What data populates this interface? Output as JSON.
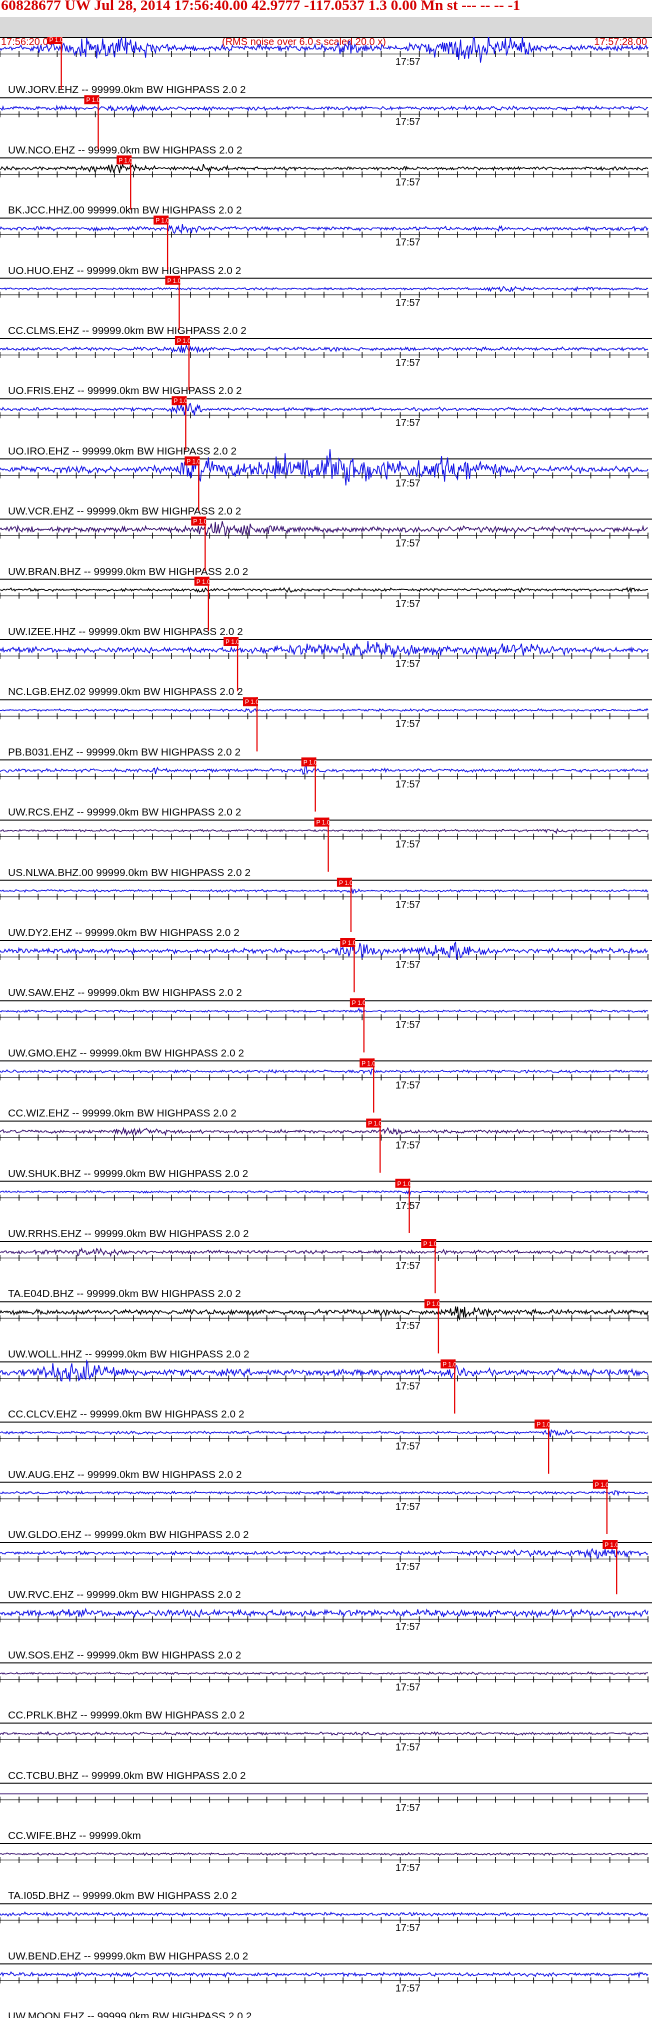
{
  "header": {
    "title": "60828677 UW Jul 28, 2014 17:56:40.00   42.9777 -117.0537  1.3 0.00 Mn st --- -- --  -1",
    "start_time": "17:56:20.00",
    "rms_note": "(RMS noise over 6.0 s scaled 20.0 x)",
    "end_time": "17:57:28.00"
  },
  "colors": {
    "blue": "#1414e6",
    "purple": "#3a1470",
    "black": "#000000",
    "pick": "#e60000",
    "line": "#000000",
    "background": "#ffffff"
  },
  "chart_data": {
    "type": "line",
    "title": "60828677 UW Jul 28, 2014 17:56:40.00   42.9777 -117.0537  1.3 0.00 Mn st --- -- --  -1",
    "x_start": "17:56:20.00",
    "x_end": "17:57:28.00",
    "time_mark": "17:57",
    "pick_label": "P 1.0",
    "note": "(RMS noise over 6.0 s scaled 20.0 x)",
    "traces": [
      {
        "label": "UW.JORV.EHZ -- 99999.0km BW  HIGHPASS  2.0  2",
        "color": "blue",
        "amp": 0.5,
        "pick": 0.073,
        "bursts": [
          [
            0.13,
            0.06,
            3.0
          ],
          [
            0.21,
            0.04,
            2.0
          ],
          [
            0.53,
            0.03,
            2.2
          ],
          [
            0.72,
            0.06,
            4.5
          ],
          [
            0.8,
            0.02,
            3.0
          ]
        ]
      },
      {
        "label": "UW.NCO.EHZ -- 99999.0km BW  HIGHPASS  2.0  2",
        "color": "blue",
        "amp": 0.35,
        "pick": 0.13,
        "bursts": [
          [
            0.2,
            0.04,
            1.2
          ]
        ]
      },
      {
        "label": "BK.JCC.HHZ.00 99999.0km BW  HIGHPASS  2.0  2",
        "color": "black",
        "amp": 0.3,
        "pick": 0.18,
        "bursts": [
          [
            0.18,
            0.04,
            2.2
          ],
          [
            0.32,
            0.03,
            1.4
          ]
        ]
      },
      {
        "label": "UO.HUO.EHZ -- 99999.0km BW  HIGHPASS  2.0  2",
        "color": "blue",
        "amp": 0.35,
        "pick": 0.237,
        "bursts": [
          [
            0.28,
            0.02,
            2.8
          ],
          [
            0.77,
            0.005,
            2.5
          ]
        ]
      },
      {
        "label": "CC.CLMS.EHZ -- 99999.0km BW  HIGHPASS  2.0  2",
        "color": "blue",
        "amp": 0.2,
        "pick": 0.255,
        "bursts": [
          [
            0.78,
            0.03,
            2.2
          ],
          [
            0.91,
            0.03,
            1.2
          ]
        ]
      },
      {
        "label": "UO.FRIS.EHZ -- 99999.0km BW  HIGHPASS  2.0  2",
        "color": "blue",
        "amp": 0.35,
        "pick": 0.27,
        "bursts": [
          [
            0.285,
            0.02,
            2.0
          ]
        ]
      },
      {
        "label": "UO.IRO.EHZ -- 99999.0km BW  HIGHPASS  2.0  2",
        "color": "blue",
        "amp": 0.3,
        "pick": 0.265,
        "bursts": [
          [
            0.29,
            0.02,
            3.0
          ]
        ]
      },
      {
        "label": "UW.VCR.EHZ -- 99999.0km BW  HIGHPASS  2.0  2",
        "color": "blue",
        "amp": 0.6,
        "pick": 0.285,
        "bursts": [
          [
            0.3,
            0.03,
            3.0
          ],
          [
            0.5,
            0.12,
            4.5
          ],
          [
            0.7,
            0.06,
            3.0
          ]
        ]
      },
      {
        "label": "UW.BRAN.BHZ -- 99999.0km BW  HIGHPASS  2.0  2",
        "color": "purple",
        "amp": 0.55,
        "pick": 0.295,
        "bursts": [
          [
            0.35,
            0.05,
            1.8
          ]
        ]
      },
      {
        "label": "UW.IZEE.HHZ -- 99999.0km BW  HIGHPASS  2.0  2",
        "color": "black",
        "amp": 0.25,
        "pick": 0.3,
        "bursts": [
          [
            0.31,
            0.005,
            2.8
          ],
          [
            0.45,
            0.01,
            1.8
          ],
          [
            0.8,
            0.01,
            1.2
          ],
          [
            0.97,
            0.01,
            1.2
          ]
        ]
      },
      {
        "label": "NC.LGB.EHZ.02 99999.0km BW  HIGHPASS  2.0  2",
        "color": "blue",
        "amp": 0.5,
        "pick": 0.345,
        "bursts": [
          [
            0.55,
            0.12,
            2.0
          ],
          [
            0.8,
            0.08,
            1.4
          ]
        ]
      },
      {
        "label": "PB.B031.EHZ -- 99999.0km BW  HIGHPASS  2.0  2",
        "color": "blue",
        "amp": 0.2,
        "pick": 0.375,
        "bursts": [
          [
            0.385,
            0.005,
            3.0
          ]
        ]
      },
      {
        "label": "UW.RCS.EHZ -- 99999.0km BW  HIGHPASS  2.0  2",
        "color": "blue",
        "amp": 0.3,
        "pick": 0.465,
        "bursts": [
          [
            0.47,
            0.004,
            3.5
          ],
          [
            0.24,
            0.005,
            1.8
          ]
        ]
      },
      {
        "label": "US.NLWA.BHZ.00 99999.0km BW  HIGHPASS  2.0  2",
        "color": "purple",
        "amp": 0.2,
        "pick": 0.485,
        "bursts": [
          [
            0.85,
            0.03,
            1.2
          ]
        ]
      },
      {
        "label": "UW.DY2.EHZ -- 99999.0km BW  HIGHPASS  2.0  2",
        "color": "blue",
        "amp": 0.2,
        "pick": 0.52,
        "bursts": [
          [
            0.545,
            0.005,
            2.2
          ]
        ]
      },
      {
        "label": "UW.SAW.EHZ -- 99999.0km BW  HIGHPASS  2.0  2",
        "color": "blue",
        "amp": 0.45,
        "pick": 0.525,
        "bursts": [
          [
            0.55,
            0.03,
            2.4
          ],
          [
            0.7,
            0.05,
            3.0
          ]
        ]
      },
      {
        "label": "UW.GMO.EHZ -- 99999.0km BW  HIGHPASS  2.0  2",
        "color": "blue",
        "amp": 0.2,
        "pick": 0.54,
        "bursts": [
          [
            0.555,
            0.005,
            1.8
          ]
        ]
      },
      {
        "label": "CC.WIZ.EHZ -- 99999.0km BW  HIGHPASS  2.0  2",
        "color": "blue",
        "amp": 0.25,
        "pick": 0.555,
        "bursts": [
          [
            0.57,
            0.01,
            1.2
          ]
        ]
      },
      {
        "label": "UW.SHUK.BHZ -- 99999.0km BW  HIGHPASS  2.0  2",
        "color": "purple",
        "amp": 0.3,
        "pick": 0.565,
        "bursts": [
          [
            0.21,
            0.04,
            2.0
          ],
          [
            0.6,
            0.02,
            1.4
          ]
        ]
      },
      {
        "label": "UW.RRHS.EHZ -- 99999.0km BW  HIGHPASS  2.0  2",
        "color": "blue",
        "amp": 0.2,
        "pick": 0.61,
        "bursts": [
          [
            0.63,
            0.005,
            2.2
          ]
        ]
      },
      {
        "label": "TA.E04D.BHZ -- 99999.0km BW  HIGHPASS  2.0  2",
        "color": "purple",
        "amp": 0.3,
        "pick": 0.65,
        "bursts": [
          [
            0.15,
            0.06,
            1.4
          ],
          [
            0.685,
            0.005,
            2.0
          ]
        ]
      },
      {
        "label": "UW.WOLL.HHZ -- 99999.0km BW  HIGHPASS  2.0  2",
        "color": "black",
        "amp": 0.5,
        "pick": 0.655,
        "bursts": [
          [
            0.72,
            0.03,
            2.2
          ]
        ]
      },
      {
        "label": "CC.CLCV.EHZ -- 99999.0km BW  HIGHPASS  2.0  2",
        "color": "blue",
        "amp": 0.6,
        "pick": 0.68,
        "bursts": [
          [
            0.12,
            0.06,
            2.6
          ],
          [
            0.7,
            0.01,
            3.0
          ]
        ]
      },
      {
        "label": "UW.AUG.EHZ -- 99999.0km BW  HIGHPASS  2.0  2",
        "color": "blue",
        "amp": 0.25,
        "pick": 0.825,
        "bursts": [
          [
            0.86,
            0.02,
            2.0
          ]
        ]
      },
      {
        "label": "UW.GLDO.EHZ -- 99999.0km BW  HIGHPASS  2.0  2",
        "color": "blue",
        "amp": 0.25,
        "pick": 0.915,
        "bursts": [
          [
            0.95,
            0.01,
            1.4
          ]
        ]
      },
      {
        "label": "UW.RVC.EHZ -- 99999.0km BW  HIGHPASS  2.0  2",
        "color": "blue",
        "amp": 0.3,
        "pick": 0.93,
        "bursts": [
          [
            0.93,
            0.04,
            3.5
          ],
          [
            0.8,
            0.06,
            1.2
          ]
        ]
      },
      {
        "label": "UW.SOS.EHZ -- 99999.0km BW  HIGHPASS  2.0  2",
        "color": "blue",
        "amp": 0.65,
        "pick": null,
        "bursts": []
      },
      {
        "label": "CC.PRLK.BHZ -- 99999.0km BW  HIGHPASS  2.0  2",
        "color": "purple",
        "amp": 0.2,
        "pick": null,
        "bursts": []
      },
      {
        "label": "CC.TCBU.BHZ -- 99999.0km BW  HIGHPASS  2.0  2",
        "color": "purple",
        "amp": 0.25,
        "pick": null,
        "bursts": []
      },
      {
        "label": "CC.WIFE.BHZ -- 99999.0km",
        "color": "purple",
        "amp": 0,
        "pick": null,
        "bursts": []
      },
      {
        "label": "TA.I05D.BHZ -- 99999.0km BW  HIGHPASS  2.0  2",
        "color": "purple",
        "amp": 0.2,
        "pick": null,
        "bursts": []
      },
      {
        "label": "UW.BEND.EHZ -- 99999.0km BW  HIGHPASS  2.0  2",
        "color": "blue",
        "amp": 0.3,
        "pick": null,
        "bursts": []
      },
      {
        "label": "UW.MOON.EHZ -- 99999.0km BW  HIGHPASS  2.0  2",
        "color": "blue",
        "amp": 0.35,
        "pick": null,
        "bursts": []
      }
    ]
  }
}
